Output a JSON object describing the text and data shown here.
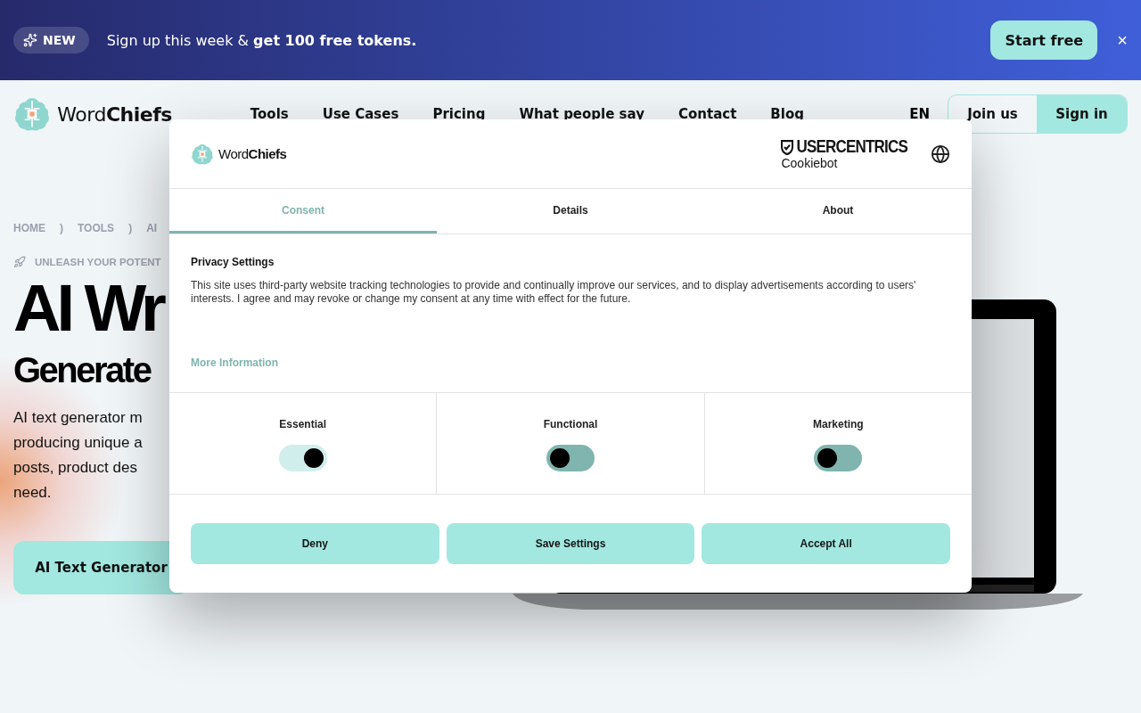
{
  "banner": {
    "badge": "NEW",
    "message": "Sign up this week & **get 100 free tokens.**",
    "cta": "Start free",
    "close": "×"
  },
  "nav": {
    "logo": "Word**Chiefs**",
    "items": [
      "Tools",
      "Use Cases",
      "Pricing",
      "What people say",
      "Contact",
      "Blog"
    ],
    "language": "EN",
    "join": "Join us",
    "sign_in": "Sign in"
  },
  "breadcrumb": [
    "HOME",
    "TOOLS",
    "AI"
  ],
  "breadcrumb_separator": ")",
  "hero": {
    "tagline": "UNLEASH YOUR POTENT",
    "title": "AI Wr",
    "subtitle": "Generate",
    "lines": [
      "AI text generator m",
      "producing unique a",
      "posts, product des",
      "need."
    ],
    "button": "AI Text Generator"
  },
  "cookie_dialog": {
    "logo": "Word**Chiefs**",
    "provider": "USERCENTRICS",
    "provider_sub": "Cookiebot",
    "tabs": [
      {
        "label": "Consent",
        "selected": true
      },
      {
        "label": "Details",
        "selected": false
      },
      {
        "label": "About",
        "selected": false
      }
    ],
    "heading": "Privacy Settings",
    "body": "This site uses third-party website tracking technologies to provide and continually improve our services, and to display advertisements according to users' interests. I agree and may revoke or change my consent at any time with effect for the future.",
    "more": "More Information",
    "categories": [
      {
        "label": "Essential",
        "checked": true,
        "disabled": true
      },
      {
        "label": "Functional",
        "checked": false,
        "disabled": false
      },
      {
        "label": "Marketing",
        "checked": false,
        "disabled": false
      }
    ],
    "buttons": [
      "Deny",
      "Save Settings",
      "Accept All"
    ]
  }
}
